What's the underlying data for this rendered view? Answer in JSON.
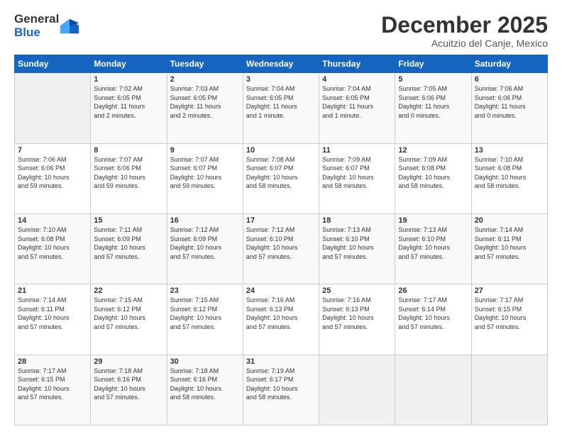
{
  "header": {
    "logo_general": "General",
    "logo_blue": "Blue",
    "month_title": "December 2025",
    "location": "Acuitzio del Canje, Mexico"
  },
  "weekdays": [
    "Sunday",
    "Monday",
    "Tuesday",
    "Wednesday",
    "Thursday",
    "Friday",
    "Saturday"
  ],
  "weeks": [
    [
      {
        "day": "",
        "info": ""
      },
      {
        "day": "1",
        "info": "Sunrise: 7:02 AM\nSunset: 6:05 PM\nDaylight: 11 hours\nand 2 minutes."
      },
      {
        "day": "2",
        "info": "Sunrise: 7:03 AM\nSunset: 6:05 PM\nDaylight: 11 hours\nand 2 minutes."
      },
      {
        "day": "3",
        "info": "Sunrise: 7:04 AM\nSunset: 6:05 PM\nDaylight: 11 hours\nand 1 minute."
      },
      {
        "day": "4",
        "info": "Sunrise: 7:04 AM\nSunset: 6:05 PM\nDaylight: 11 hours\nand 1 minute."
      },
      {
        "day": "5",
        "info": "Sunrise: 7:05 AM\nSunset: 6:06 PM\nDaylight: 11 hours\nand 0 minutes."
      },
      {
        "day": "6",
        "info": "Sunrise: 7:06 AM\nSunset: 6:06 PM\nDaylight: 11 hours\nand 0 minutes."
      }
    ],
    [
      {
        "day": "7",
        "info": "Sunrise: 7:06 AM\nSunset: 6:06 PM\nDaylight: 10 hours\nand 59 minutes."
      },
      {
        "day": "8",
        "info": "Sunrise: 7:07 AM\nSunset: 6:06 PM\nDaylight: 10 hours\nand 59 minutes."
      },
      {
        "day": "9",
        "info": "Sunrise: 7:07 AM\nSunset: 6:07 PM\nDaylight: 10 hours\nand 59 minutes."
      },
      {
        "day": "10",
        "info": "Sunrise: 7:08 AM\nSunset: 6:07 PM\nDaylight: 10 hours\nand 58 minutes."
      },
      {
        "day": "11",
        "info": "Sunrise: 7:09 AM\nSunset: 6:07 PM\nDaylight: 10 hours\nand 58 minutes."
      },
      {
        "day": "12",
        "info": "Sunrise: 7:09 AM\nSunset: 6:08 PM\nDaylight: 10 hours\nand 58 minutes."
      },
      {
        "day": "13",
        "info": "Sunrise: 7:10 AM\nSunset: 6:08 PM\nDaylight: 10 hours\nand 58 minutes."
      }
    ],
    [
      {
        "day": "14",
        "info": "Sunrise: 7:10 AM\nSunset: 6:08 PM\nDaylight: 10 hours\nand 57 minutes."
      },
      {
        "day": "15",
        "info": "Sunrise: 7:11 AM\nSunset: 6:09 PM\nDaylight: 10 hours\nand 57 minutes."
      },
      {
        "day": "16",
        "info": "Sunrise: 7:12 AM\nSunset: 6:09 PM\nDaylight: 10 hours\nand 57 minutes."
      },
      {
        "day": "17",
        "info": "Sunrise: 7:12 AM\nSunset: 6:10 PM\nDaylight: 10 hours\nand 57 minutes."
      },
      {
        "day": "18",
        "info": "Sunrise: 7:13 AM\nSunset: 6:10 PM\nDaylight: 10 hours\nand 57 minutes."
      },
      {
        "day": "19",
        "info": "Sunrise: 7:13 AM\nSunset: 6:10 PM\nDaylight: 10 hours\nand 57 minutes."
      },
      {
        "day": "20",
        "info": "Sunrise: 7:14 AM\nSunset: 6:11 PM\nDaylight: 10 hours\nand 57 minutes."
      }
    ],
    [
      {
        "day": "21",
        "info": "Sunrise: 7:14 AM\nSunset: 6:11 PM\nDaylight: 10 hours\nand 57 minutes."
      },
      {
        "day": "22",
        "info": "Sunrise: 7:15 AM\nSunset: 6:12 PM\nDaylight: 10 hours\nand 57 minutes."
      },
      {
        "day": "23",
        "info": "Sunrise: 7:15 AM\nSunset: 6:12 PM\nDaylight: 10 hours\nand 57 minutes."
      },
      {
        "day": "24",
        "info": "Sunrise: 7:16 AM\nSunset: 6:13 PM\nDaylight: 10 hours\nand 57 minutes."
      },
      {
        "day": "25",
        "info": "Sunrise: 7:16 AM\nSunset: 6:13 PM\nDaylight: 10 hours\nand 57 minutes."
      },
      {
        "day": "26",
        "info": "Sunrise: 7:17 AM\nSunset: 6:14 PM\nDaylight: 10 hours\nand 57 minutes."
      },
      {
        "day": "27",
        "info": "Sunrise: 7:17 AM\nSunset: 6:15 PM\nDaylight: 10 hours\nand 57 minutes."
      }
    ],
    [
      {
        "day": "28",
        "info": "Sunrise: 7:17 AM\nSunset: 6:15 PM\nDaylight: 10 hours\nand 57 minutes."
      },
      {
        "day": "29",
        "info": "Sunrise: 7:18 AM\nSunset: 6:16 PM\nDaylight: 10 hours\nand 57 minutes."
      },
      {
        "day": "30",
        "info": "Sunrise: 7:18 AM\nSunset: 6:16 PM\nDaylight: 10 hours\nand 58 minutes."
      },
      {
        "day": "31",
        "info": "Sunrise: 7:19 AM\nSunset: 6:17 PM\nDaylight: 10 hours\nand 58 minutes."
      },
      {
        "day": "",
        "info": ""
      },
      {
        "day": "",
        "info": ""
      },
      {
        "day": "",
        "info": ""
      }
    ]
  ]
}
